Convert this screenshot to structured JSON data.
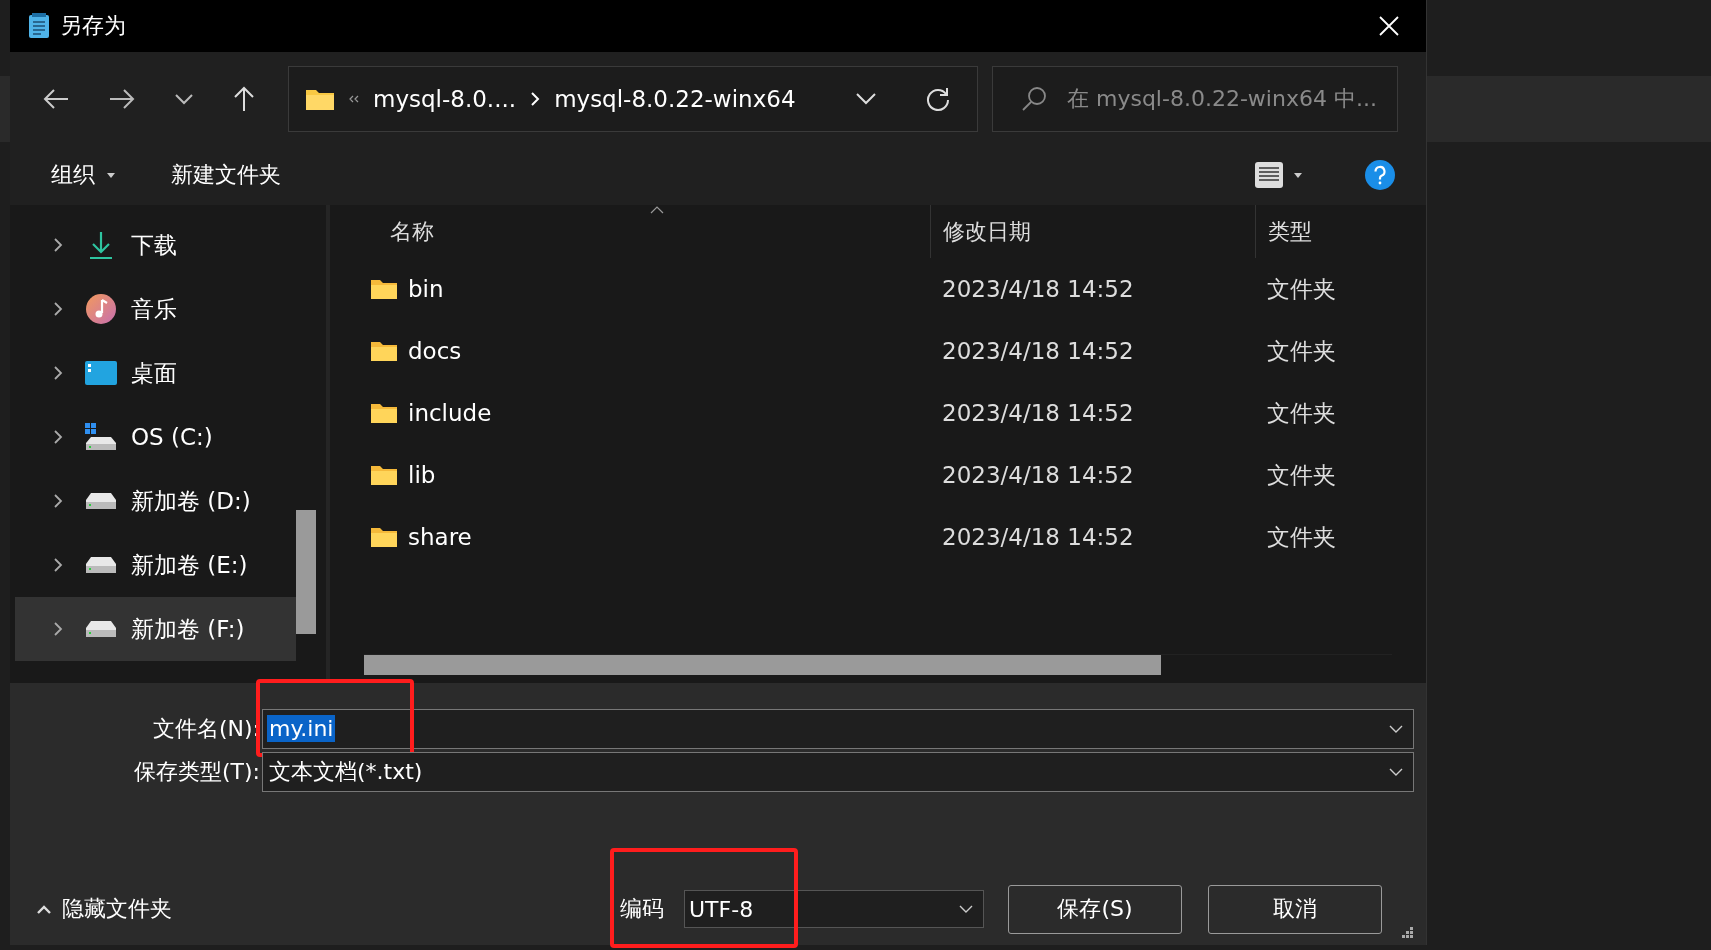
{
  "window": {
    "title": "另存为"
  },
  "address": {
    "crumbs": [
      "mysql-8.0....",
      "mysql-8.0.22-winx64"
    ]
  },
  "search": {
    "placeholder": "在 mysql-8.0.22-winx64 中..."
  },
  "commands": [
    {
      "label": "组织",
      "dropdown": true
    },
    {
      "label": "新建文件夹",
      "dropdown": false
    }
  ],
  "sidebar": {
    "items": [
      {
        "label": "下载",
        "kind": "download",
        "selected": false
      },
      {
        "label": "音乐",
        "kind": "music",
        "selected": false
      },
      {
        "label": "桌面",
        "kind": "desktop",
        "selected": false
      },
      {
        "label": "OS (C:)",
        "kind": "system-drive",
        "selected": false
      },
      {
        "label": "新加卷 (D:)",
        "kind": "drive",
        "selected": false
      },
      {
        "label": "新加卷 (E:)",
        "kind": "drive",
        "selected": false
      },
      {
        "label": "新加卷 (F:)",
        "kind": "drive",
        "selected": true
      }
    ]
  },
  "table": {
    "columns": [
      "名称",
      "修改日期",
      "类型"
    ],
    "rows": [
      {
        "name": "bin",
        "modified": "2023/4/18 14:52",
        "type": "文件夹"
      },
      {
        "name": "docs",
        "modified": "2023/4/18 14:52",
        "type": "文件夹"
      },
      {
        "name": "include",
        "modified": "2023/4/18 14:52",
        "type": "文件夹"
      },
      {
        "name": "lib",
        "modified": "2023/4/18 14:52",
        "type": "文件夹"
      },
      {
        "name": "share",
        "modified": "2023/4/18 14:52",
        "type": "文件夹"
      }
    ]
  },
  "file_name": {
    "label": "文件名(N):",
    "value": "my.ini",
    "selected": true,
    "highlighted": true
  },
  "file_type": {
    "label": "保存类型(T):",
    "value": "文本文档(*.txt)"
  },
  "encoding": {
    "label": "编码",
    "value": "UTF-8",
    "highlighted": true
  },
  "hide_folders": {
    "label": "隐藏文件夹",
    "expanded": true
  },
  "buttons": [
    {
      "label": "保存(S)"
    },
    {
      "label": "取消"
    }
  ]
}
